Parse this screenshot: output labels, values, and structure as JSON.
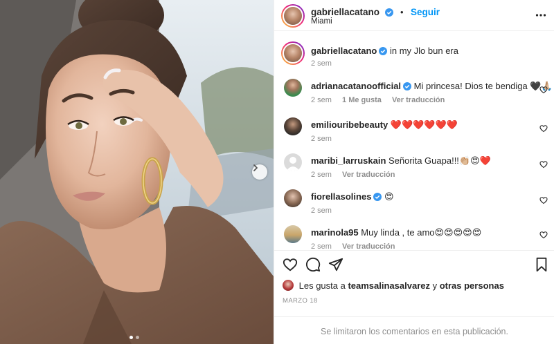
{
  "post": {
    "photo_icon": "portrait-photo",
    "carousel": {
      "total": 2,
      "current": 1
    },
    "next_icon": "chevron-right-icon"
  },
  "header": {
    "username": "gabriellacatano",
    "verified": true,
    "bullet": "•",
    "follow_label": "Seguir",
    "location": "Miami",
    "more_icon": "more-options-icon"
  },
  "caption": {
    "username": "gabriellacatano",
    "verified": true,
    "text": "in my Jlo bun era",
    "time": "2 sem"
  },
  "comments": [
    {
      "username": "adrianacatanoofficial",
      "verified": true,
      "text": "Mi princesa! Dios te bendiga 🖤🙏🏼",
      "time": "2 sem",
      "likes": "1 Me gusta",
      "translate": "Ver traducción",
      "avatar_color": "#3a8a4e"
    },
    {
      "username": "emiliouribebeauty",
      "verified": false,
      "text": "❤️❤️❤️❤️❤️❤️",
      "time": "2 sem",
      "likes": "",
      "translate": "",
      "avatar_color": "#2c2a28"
    },
    {
      "username": "maribi_larruskain",
      "verified": false,
      "text": "Señorita Guapa!!!👏🏼😍❤️",
      "time": "2 sem",
      "likes": "",
      "translate": "Ver traducción",
      "avatar_color": "#dbdbdb"
    },
    {
      "username": "fiorellasolines",
      "verified": true,
      "text": "😍",
      "time": "2 sem",
      "likes": "",
      "translate": "",
      "avatar_color": "#8a6a55"
    },
    {
      "username": "marinola95",
      "verified": false,
      "text": "Muy linda , te amo😍😍😍😍😍",
      "time": "2 sem",
      "likes": "",
      "translate": "Ver traducción",
      "avatar_color": "#c9a56a"
    }
  ],
  "actions": {
    "like_icon": "heart-icon",
    "comment_icon": "comment-icon",
    "share_icon": "share-icon",
    "save_icon": "bookmark-icon"
  },
  "likes_line": {
    "prefix": "Les gusta a ",
    "user": "teamsalinasalvarez",
    "middle": " y ",
    "others": "otras personas"
  },
  "date": "MARZO 18",
  "comments_limited": "Se limitaron los comentarios en esta publicación.",
  "colors": {
    "link": "#0095f6",
    "verified": "#3897f0",
    "muted": "#8e8e8e",
    "text": "#262626",
    "border": "#efefef"
  }
}
